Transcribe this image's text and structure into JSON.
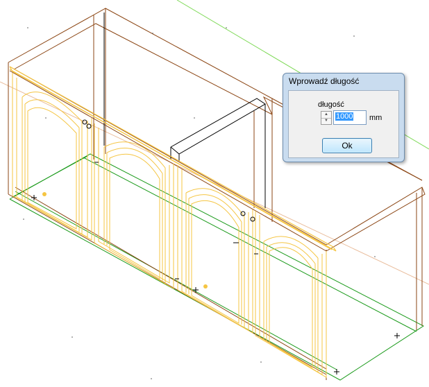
{
  "dialog": {
    "title": "Wprowadź długość",
    "field_label": "długość",
    "value": "1000",
    "unit": "mm",
    "ok_label": "Ok",
    "spin_up_icon": "triangle-up-icon",
    "spin_down_icon": "triangle-down-icon"
  },
  "viewport": {
    "view": "isometric wireframe",
    "colors": {
      "background": "#ffffff",
      "carcass_lines": "#8b4513",
      "door_frames": "#f5c542",
      "base_lines": "#1a9a1a",
      "axis_line": "#7ed957",
      "selected_panel": "#000000"
    }
  }
}
